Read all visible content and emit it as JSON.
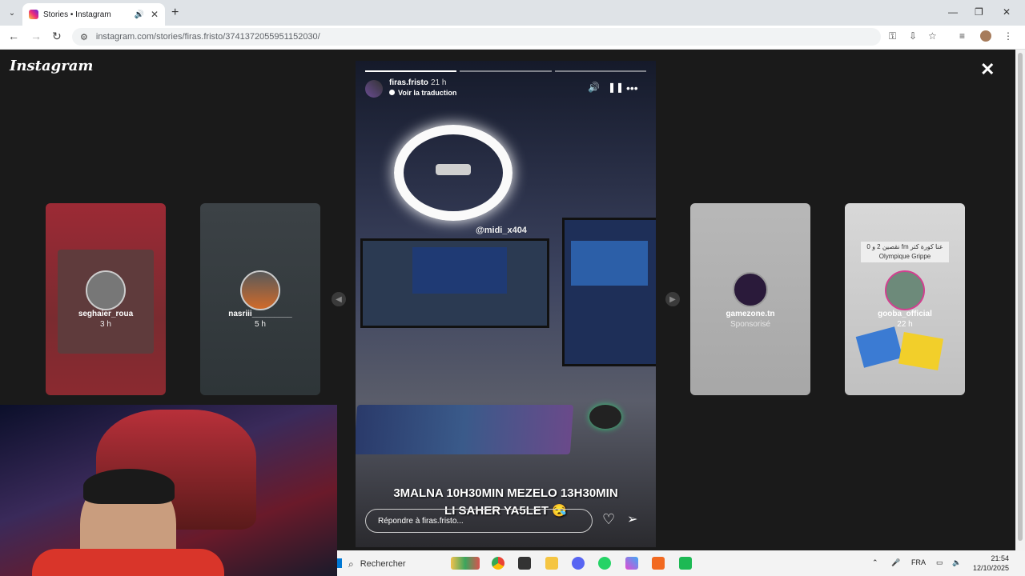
{
  "browser": {
    "tab_title": "Stories • Instagram",
    "url": "instagram.com/stories/firas.fristo/3741372055951152030/",
    "new_tab_label": "+"
  },
  "instagram": {
    "logo": "Instagram",
    "close_label": "✕",
    "side_stories": [
      {
        "username": "seghaier_roua",
        "meta": "3 h"
      },
      {
        "username": "nasriii_________",
        "meta": "5 h"
      },
      {
        "username": "gamezone.tn",
        "meta": "Sponsorisé"
      },
      {
        "username": "gooba_official",
        "meta": "22 h",
        "banner": "نقصين 2 و 0 fm عنا كورة كتر Olympique Grippe"
      }
    ],
    "story": {
      "username": "firas.fristo",
      "time": "21 h",
      "translate": "Voir la traduction",
      "tag": "@midi_x404",
      "caption_line1": "3MALNA 10H30MIN MEZELO 13H30MIN",
      "caption_line2": "LI SAHER YA5LET 😪",
      "reply_placeholder": "Répondre à firas.fristo...",
      "progress": [
        1,
        0,
        0
      ]
    }
  },
  "taskbar": {
    "search_label": "Rechercher",
    "lang": "FRA",
    "time": "21:54",
    "date": "12/10/2025"
  },
  "colors": {
    "instagram_bg": "#1a1a1a",
    "story_ring": "#d23f8f",
    "windows_blue": "#0078d4"
  }
}
